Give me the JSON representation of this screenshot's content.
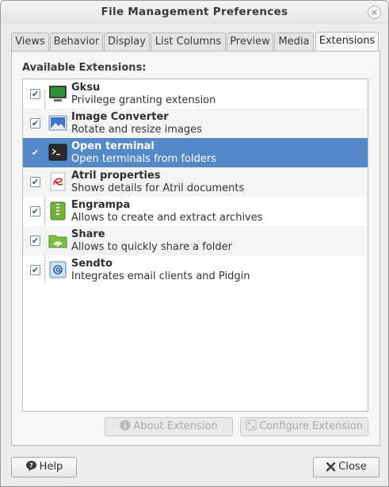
{
  "window": {
    "title": "File Management Preferences",
    "close_glyph": "×"
  },
  "tabs": [
    {
      "label": "Views"
    },
    {
      "label": "Behavior"
    },
    {
      "label": "Display"
    },
    {
      "label": "List Columns"
    },
    {
      "label": "Preview"
    },
    {
      "label": "Media"
    },
    {
      "label": "Extensions",
      "active": true
    }
  ],
  "extensions": {
    "section_label": "Available Extensions:",
    "items": [
      {
        "name": "Gksu",
        "description": "Privilege granting extension",
        "enabled": true,
        "icon": "monitor-icon"
      },
      {
        "name": "Image Converter",
        "description": "Rotate and resize images",
        "enabled": true,
        "icon": "image-icon"
      },
      {
        "name": "Open terminal",
        "description": "Open terminals from folders",
        "enabled": true,
        "icon": "terminal-icon",
        "selected": true
      },
      {
        "name": "Atril properties",
        "description": "Shows details for Atril documents",
        "enabled": true,
        "icon": "atril-icon"
      },
      {
        "name": "Engrampa",
        "description": "Allows to create and extract archives",
        "enabled": true,
        "icon": "archive-icon"
      },
      {
        "name": "Share",
        "description": "Allows to quickly share a folder",
        "enabled": true,
        "icon": "share-folder-icon"
      },
      {
        "name": "Sendto",
        "description": "Integrates email clients and Pidgin",
        "enabled": true,
        "icon": "email-icon"
      }
    ],
    "about_button": "About Extension",
    "configure_button": "Configure Extension"
  },
  "footer": {
    "help_button": "Help",
    "close_button": "Close"
  },
  "colors": {
    "selection": "#5389c6",
    "window_bg": "#ececec"
  }
}
